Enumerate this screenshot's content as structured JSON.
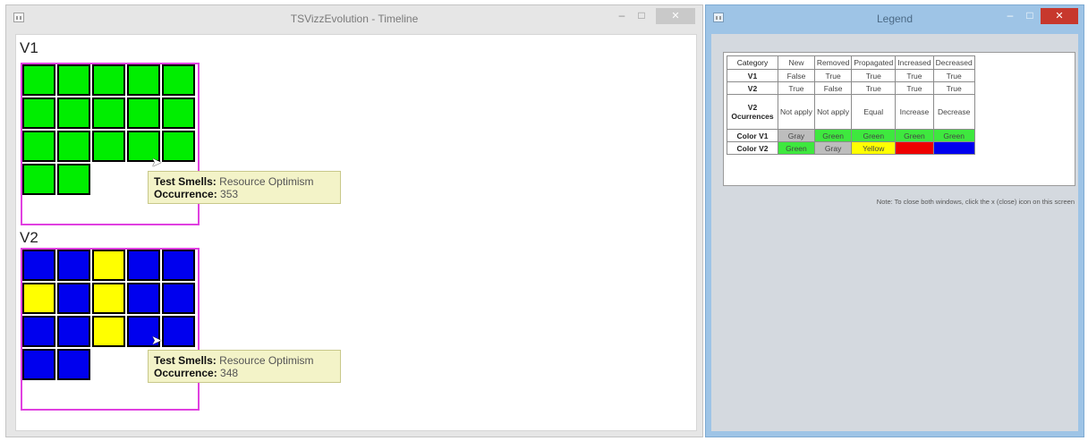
{
  "timeline_window": {
    "title": "TSVizzEvolution - Timeline",
    "controls": {
      "minimize": "–",
      "maximize": "□",
      "close": "✕"
    }
  },
  "timeline": {
    "v1": {
      "label": "V1",
      "cells": [
        "#00ee00",
        "#00ee00",
        "#00ee00",
        "#00ee00",
        "#00ee00",
        "#00ee00",
        "#00ee00",
        "#00ee00",
        "#00ee00",
        "#00ee00",
        "#00ee00",
        "#00ee00",
        "#00ee00",
        "#00ee00",
        "#00ee00",
        "#00ee00",
        "#00ee00"
      ],
      "tooltip": {
        "smell_key": "Test Smells:",
        "smell_value": "Resource Optimism",
        "occ_key": "Occurrence:",
        "occ_value": "353"
      }
    },
    "v2": {
      "label": "V2",
      "cells": [
        "#0000ee",
        "#0000ee",
        "#ffff00",
        "#0000ee",
        "#0000ee",
        "#ffff00",
        "#0000ee",
        "#ffff00",
        "#0000ee",
        "#0000ee",
        "#0000ee",
        "#0000ee",
        "#ffff00",
        "#0000ee",
        "#0000ee",
        "#0000ee",
        "#0000ee"
      ],
      "tooltip": {
        "smell_key": "Test Smells:",
        "smell_value": "Resource Optimism",
        "occ_key": "Occurrence:",
        "occ_value": "348"
      }
    },
    "colors": {
      "frame": "#e040e0",
      "green": "#00ee00",
      "blue": "#0000ee",
      "yellow": "#ffff00"
    }
  },
  "legend_window": {
    "title": "Legend",
    "controls": {
      "minimize": "–",
      "maximize": "□",
      "close": "✕"
    },
    "table": {
      "headers": [
        "Category",
        "New",
        "Removed",
        "Propagated",
        "Increased",
        "Decreased"
      ],
      "rows": [
        {
          "category": "V1",
          "cells": [
            "False",
            "True",
            "True",
            "True",
            "True"
          ]
        },
        {
          "category": "V2",
          "cells": [
            "True",
            "False",
            "True",
            "True",
            "True"
          ]
        },
        {
          "category": "V2 Ocurrences",
          "cells": [
            "Not apply",
            "Not apply",
            "Equal",
            "Increase",
            "Decrease"
          ]
        },
        {
          "category": "Color V1",
          "cells": [
            "Gray",
            "Green",
            "Green",
            "Green",
            "Green"
          ],
          "colors": [
            "#bdbdbd",
            "#3ee83e",
            "#3ee83e",
            "#3ee83e",
            "#3ee83e"
          ]
        },
        {
          "category": "Color V2",
          "cells": [
            "Green",
            "Gray",
            "Yellow",
            "Red",
            "Blue"
          ],
          "colors": [
            "#3ee83e",
            "#bdbdbd",
            "#ffff00",
            "#ee0000",
            "#0000ee"
          ]
        }
      ]
    },
    "note": "Note: To close both windows, click the x (close) icon on this screen"
  }
}
